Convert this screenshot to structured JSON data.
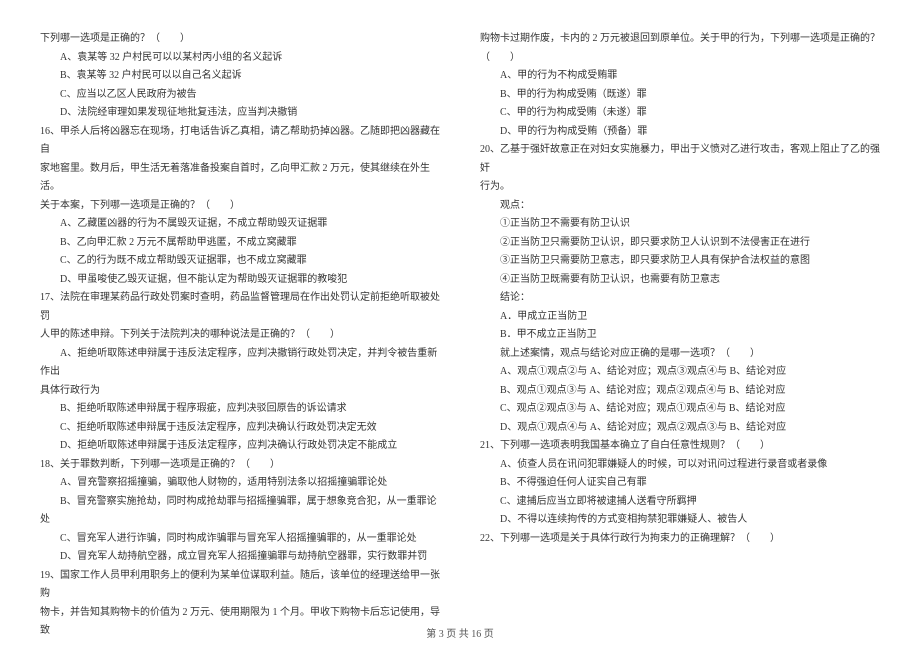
{
  "left": {
    "lines": [
      "下列哪一选项是正确的？（　　）",
      "　　A、袁某等 32 户村民可以以某村丙小组的名义起诉",
      "　　B、袁某等 32 户村民可以以自己名义起诉",
      "　　C、应当以乙区人民政府为被告",
      "　　D、法院经审理如果发现征地批复违法，应当判决撤销",
      "16、甲杀人后将凶器忘在现场，打电话告诉乙真相，请乙帮助扔掉凶器。乙随即把凶器藏在自",
      "家地窖里。数月后，甲生活无着落准备投案自首时，乙向甲汇款 2 万元，使其继续在外生活。",
      "关于本案，下列哪一选项是正确的？（　　）",
      "　　A、乙藏匿凶器的行为不属毁灭证据，不成立帮助毁灭证据罪",
      "　　B、乙向甲汇款 2 万元不属帮助甲逃匿，不成立窝藏罪",
      "　　C、乙的行为既不成立帮助毁灭证据罪，也不成立窝藏罪",
      "　　D、甲虽唆使乙毁灭证据，但不能认定为帮助毁灭证据罪的教唆犯",
      "17、法院在审理某药品行政处罚案时查明，药品监督管理局在作出处罚认定前拒绝听取被处罚",
      "人甲的陈述申辩。下列关于法院判决的哪种说法是正确的？（　　）",
      "　　A、拒绝听取陈述申辩属于违反法定程序，应判决撤销行政处罚决定，并判令被告重新作出",
      "具体行政行为",
      "　　B、拒绝听取陈述申辩属于程序瑕疵，应判决驳回原告的诉讼请求",
      "　　C、拒绝听取陈述申辩属于违反法定程序，应判决确认行政处罚决定无效",
      "　　D、拒绝听取陈述申辩属于违反法定程序，应判决确认行政处罚决定不能成立",
      "18、关于罪数判断，下列哪一选项是正确的？（　　）",
      "　　A、冒充警察招摇撞骗，骗取他人财物的，适用特别法条以招摇撞骗罪论处",
      "　　B、冒充警察实施抢劫，同时构成抢劫罪与招摇撞骗罪，属于想象竞合犯，从一重罪论处",
      "　　C、冒充军人进行诈骗，同时构成诈骗罪与冒充军人招摇撞骗罪的，从一重罪论处",
      "　　D、冒充军人劫持航空器，成立冒充军人招摇撞骗罪与劫持航空器罪，实行数罪并罚",
      "19、国家工作人员甲利用职务上的便利为某单位谋取利益。随后，该单位的经理送给甲一张购",
      "物卡，并告知其购物卡的价值为 2 万元、使用期限为 1 个月。甲收下购物卡后忘记使用，导致"
    ]
  },
  "right": {
    "lines": [
      "购物卡过期作废，卡内的 2 万元被退回到原单位。关于甲的行为，下列哪一选项是正确的？（　　）",
      "　　A、甲的行为不构成受贿罪",
      "　　B、甲的行为构成受贿（既遂）罪",
      "　　C、甲的行为构成受贿（未遂）罪",
      "　　D、甲的行为构成受贿（预备）罪",
      "20、乙基于强奸故意正在对妇女实施暴力，甲出于义愤对乙进行攻击，客观上阻止了乙的强奸",
      "行为。",
      "　　观点：",
      "　　①正当防卫不需要有防卫认识",
      "　　②正当防卫只需要防卫认识，即只要求防卫人认识到不法侵害正在进行",
      "　　③正当防卫只需要防卫意志，即只要求防卫人具有保护合法权益的意图",
      "　　④正当防卫既需要有防卫认识，也需要有防卫意志",
      "　　结论：",
      "　　A．甲成立正当防卫",
      "　　B．甲不成立正当防卫",
      "　　就上述案情，观点与结论对应正确的是哪一选项？（　　）",
      "　　A、观点①观点②与 A、结论对应；观点③观点④与 B、结论对应",
      "　　B、观点①观点③与 A、结论对应；观点②观点④与 B、结论对应",
      "　　C、观点②观点③与 A、结论对应；观点①观点④与 B、结论对应",
      "　　D、观点①观点④与 A、结论对应；观点②观点③与 B、结论对应",
      "21、下列哪一选项表明我国基本确立了自白任意性规则？（　　）",
      "　　A、侦查人员在讯问犯罪嫌疑人的时候，可以对讯问过程进行录音或者录像",
      "　　B、不得强迫任何人证实自己有罪",
      "　　C、逮捕后应当立即将被逮捕人送看守所羁押",
      "　　D、不得以连续拘传的方式变相拘禁犯罪嫌疑人、被告人",
      "22、下列哪一选项是关于具体行政行为拘束力的正确理解？（　　）"
    ]
  },
  "footer": "第 3 页 共 16 页"
}
